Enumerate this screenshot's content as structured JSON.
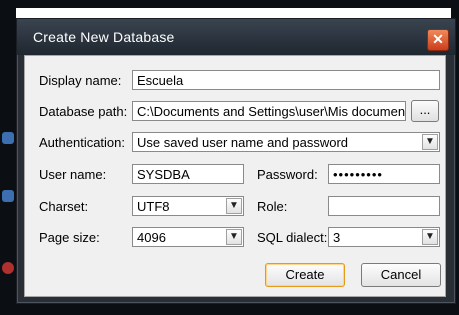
{
  "window": {
    "title": "Create New Database",
    "close_glyph": "✕"
  },
  "fields": {
    "display_name": {
      "label": "Display name:",
      "value": "Escuela"
    },
    "database_path": {
      "label": "Database path:",
      "value": "C:\\Documents and Settings\\user\\Mis documentos",
      "browse_label": "..."
    },
    "authentication": {
      "label": "Authentication:",
      "value": "Use saved user name and password"
    },
    "user_name": {
      "label": "User name:",
      "value": "SYSDBA"
    },
    "password": {
      "label": "Password:",
      "value": "•••••••••"
    },
    "charset": {
      "label": "Charset:",
      "value": "UTF8"
    },
    "role": {
      "label": "Role:",
      "value": ""
    },
    "page_size": {
      "label": "Page size:",
      "value": "4096"
    },
    "sql_dialect": {
      "label": "SQL dialect:",
      "value": "3"
    }
  },
  "buttons": {
    "create": "Create",
    "cancel": "Cancel"
  },
  "icons": {
    "dropdown": "chevron-down-icon",
    "close": "close-icon"
  },
  "colors": {
    "title_bar": "#2a2f36",
    "dialog_bg": "#f0f0f0",
    "close_red": "#cc3d1b",
    "default_button_border": "#e59a19"
  }
}
